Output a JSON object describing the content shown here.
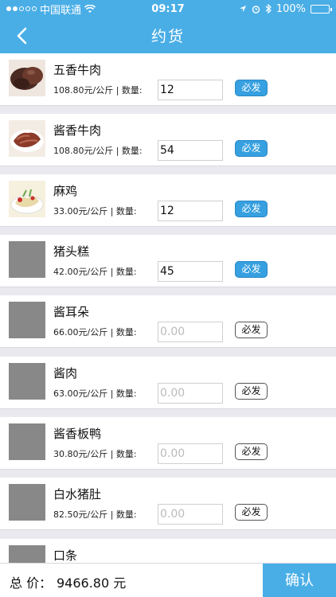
{
  "status_bar": {
    "carrier": "中国联通",
    "time": "09:17",
    "battery": "100%"
  },
  "header": {
    "title": "约货",
    "back_icon": "chevron-left-icon"
  },
  "items": [
    {
      "name": "五香牛肉",
      "price": "108.80元/公斤 | 数量:",
      "qty": "12",
      "placeholder": "0.00",
      "must_label": "必发",
      "must_active": true,
      "image": "beef-photo"
    },
    {
      "name": "酱香牛肉",
      "price": "108.80元/公斤 | 数量:",
      "qty": "54",
      "placeholder": "0.00",
      "must_label": "必发",
      "must_active": true,
      "image": "sliced-beef-photo"
    },
    {
      "name": "麻鸡",
      "price": "33.00元/公斤 | 数量:",
      "qty": "12",
      "placeholder": "0.00",
      "must_label": "必发",
      "must_active": true,
      "image": "chicken-dish-photo"
    },
    {
      "name": "猪头糕",
      "price": "42.00元/公斤 | 数量:",
      "qty": "45",
      "placeholder": "0.00",
      "must_label": "必发",
      "must_active": true,
      "image": "placeholder"
    },
    {
      "name": "酱耳朵",
      "price": "66.00元/公斤 | 数量:",
      "qty": "",
      "placeholder": "0.00",
      "must_label": "必发",
      "must_active": false,
      "image": "placeholder"
    },
    {
      "name": "酱肉",
      "price": "63.00元/公斤 | 数量:",
      "qty": "",
      "placeholder": "0.00",
      "must_label": "必发",
      "must_active": false,
      "image": "placeholder"
    },
    {
      "name": "酱香板鸭",
      "price": "30.80元/公斤 | 数量:",
      "qty": "",
      "placeholder": "0.00",
      "must_label": "必发",
      "must_active": false,
      "image": "placeholder"
    },
    {
      "name": "白水猪肚",
      "price": "82.50元/公斤 | 数量:",
      "qty": "",
      "placeholder": "0.00",
      "must_label": "必发",
      "must_active": false,
      "image": "placeholder"
    },
    {
      "name": "口条",
      "price": "",
      "qty": "",
      "placeholder": "",
      "must_label": "",
      "must_active": false,
      "image": "placeholder"
    }
  ],
  "footer": {
    "total_label": "总 价：",
    "total_value": "9466.80 元",
    "confirm_label": "确认"
  },
  "colors": {
    "accent": "#4aaee6",
    "button_active": "#36a0e0"
  }
}
